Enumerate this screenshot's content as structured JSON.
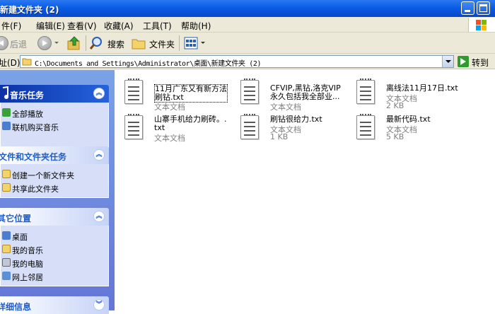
{
  "window": {
    "title": "新建文件夹 (2)"
  },
  "menu": [
    {
      "label": "件(F)"
    },
    {
      "label": "编辑(E)"
    },
    {
      "label": "查看(V)"
    },
    {
      "label": "收藏(A)"
    },
    {
      "label": "工具(T)"
    },
    {
      "label": "帮助(H)"
    }
  ],
  "toolbar": {
    "back_label": "后退",
    "search_label": "搜索",
    "folders_label": "文件夹"
  },
  "address": {
    "label": "址(D)",
    "path": "C:\\Documents and Settings\\Administrator\\桌面\\新建文件夹 (2)",
    "go_label": "转到"
  },
  "sidebar": {
    "music_tasks": {
      "title": "音乐任务",
      "items": [
        {
          "label": "全部播放"
        },
        {
          "label": "联机购买音乐"
        }
      ]
    },
    "file_tasks": {
      "title": "文件和文件夹任务",
      "items": [
        {
          "label": "创建一个新文件夹"
        },
        {
          "label": "共享此文件夹"
        }
      ]
    },
    "other_places": {
      "title": "其它位置",
      "items": [
        {
          "label": "桌面"
        },
        {
          "label": "我的音乐"
        },
        {
          "label": "我的电脑"
        },
        {
          "label": "网上邻居"
        }
      ]
    },
    "details": {
      "title": "详细信息"
    }
  },
  "files": [
    {
      "name": "11月广东又有新方法刷钻.txt",
      "type": "文本文档",
      "size": ""
    },
    {
      "name": "CFVIP,黑钻,洛克VIP永久包括我全部业...",
      "type": "文本文档",
      "size": ""
    },
    {
      "name": "离线法11月17日.txt",
      "type": "文本文档",
      "size": "2 KB"
    },
    {
      "name": "山寨手机给力刷砖。.txt",
      "type": "文本文档",
      "size": ""
    },
    {
      "name": "刷钻很给力.txt",
      "type": "文本文档",
      "size": "1 KB"
    },
    {
      "name": "最新代码.txt",
      "type": "文本文档",
      "size": "5 KB"
    }
  ],
  "colors": {
    "titlebar": "#0a5ce6",
    "sidebar_bg": "#7ba2e7",
    "pane_title": "#215dc6",
    "go_green": "#2e9b2e"
  }
}
